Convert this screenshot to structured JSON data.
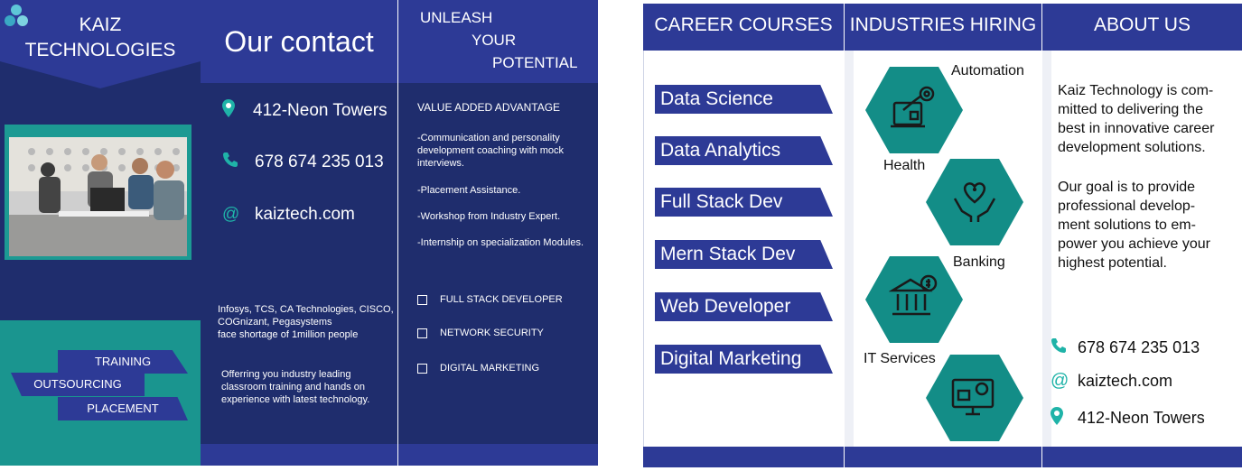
{
  "left_brochure": {
    "brand": {
      "line1": "KAIZ",
      "line2": "TECHNOLOGIES"
    },
    "services": [
      "TRAINING",
      "OUTSOURCING",
      "PLACEMENT"
    ],
    "contact": {
      "title": "Our contact",
      "address": "412-Neon Towers",
      "phone": "678 674 235 013",
      "email": "kaiztech.com",
      "shortage_text": [
        "Infosys, TCS, CA Technologies, CISCO,",
        "COGnizant, Pegasystems",
        "face shortage of 1million people"
      ],
      "offer_text": [
        "Offerring you industry leading",
        "classroom training and hands on",
        "experience with latest technology."
      ]
    },
    "potential": {
      "line1": "UNLEASH",
      "line2": "YOUR",
      "line3": "POTENTIAL",
      "value_heading": "VALUE ADDED ADVANTAGE",
      "bullets": [
        "-Communication and personality development coaching with mock interviews.",
        "-Placement Assistance.",
        "-Workshop from Industry Expert.",
        "-Internship on specialization Modules."
      ],
      "checklist": [
        "FULL STACK DEVELOPER",
        "NETWORK SECURITY",
        "DIGITAL MARKETING"
      ]
    }
  },
  "right_brochure": {
    "career": {
      "title": "CAREER COURSES",
      "courses": [
        "Data Science",
        "Data Analytics",
        "Full Stack Dev",
        "Mern Stack Dev",
        "Web Developer",
        "Digital Marketing"
      ]
    },
    "industries": {
      "title": "INDUSTRIES HIRING",
      "items": [
        "Automation",
        "Health",
        "Banking",
        "IT Services"
      ]
    },
    "about": {
      "title": "ABOUT US",
      "para1": [
        "Kaiz Technology is com-",
        "mitted to delivering the",
        "best in innovative career",
        "development solutions."
      ],
      "para2": [
        "Our goal is to provide",
        "professional develop-",
        "ment solutions to em-",
        "power you achieve your",
        "highest potential."
      ],
      "phone": "678 674 235 013",
      "email": "kaiztech.com",
      "address": "412-Neon Towers"
    }
  },
  "icons": {
    "location": "map-pin-icon",
    "phone": "phone-icon",
    "email": "at-sign-icon",
    "logo": "molecule-logo-icon",
    "automation": "robot-arm-icon",
    "health": "heart-hands-icon",
    "banking": "bank-building-icon",
    "it": "monitor-gear-icon"
  },
  "colors": {
    "navy": "#1f2d6d",
    "blue": "#2d3a96",
    "teal": "#1a958f",
    "accent_teal": "#1fb3a8"
  }
}
